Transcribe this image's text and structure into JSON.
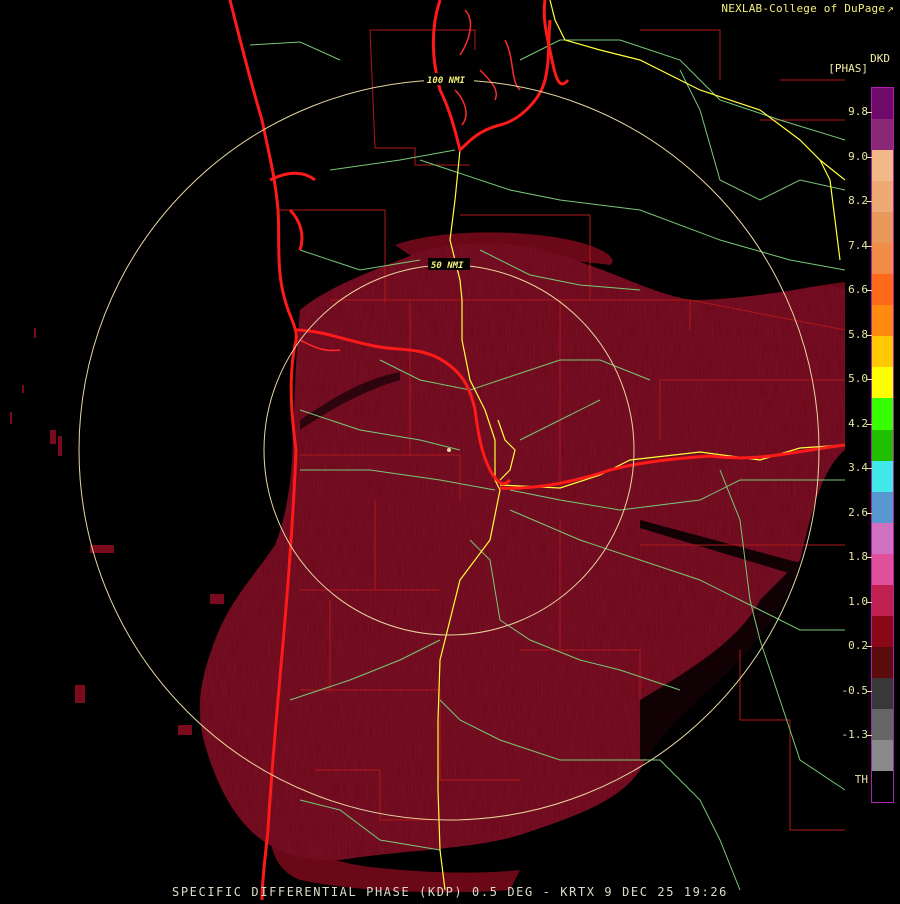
{
  "header": {
    "credit": "NEXLAB-College of DuPage",
    "credit_icon": "external-link-icon"
  },
  "footer": {
    "title": "SPECIFIC DIFFERENTIAL PHASE (KDP) 0.5 DEG - KRTX 9 DEC 25 19:26"
  },
  "map": {
    "range_rings": [
      {
        "label": "50 NMI",
        "range_nmi": 50
      },
      {
        "label": "100 NMI",
        "range_nmi": 100
      }
    ],
    "colors": {
      "background": "#000000",
      "echo_fill": "#6a0818",
      "state_borders": "#ff1a1a",
      "county_lines": "#b01818",
      "highways": "#78c878",
      "interstates": "#ffff3c",
      "range_rings": "#e8d6a0",
      "ring_labels": "#f6f27a"
    }
  },
  "colorbar": {
    "product": "DKD",
    "units": "[PHAS]",
    "ticks": [
      "9.8",
      "9.0",
      "8.2",
      "7.4",
      "6.6",
      "5.8",
      "5.0",
      "4.2",
      "3.4",
      "2.6",
      "1.8",
      "1.0",
      "0.2",
      "-0.5",
      "-1.3",
      "TH"
    ],
    "swatches": [
      "#700a6a",
      "#8a2878",
      "#f2b888",
      "#eeaa74",
      "#e8985a",
      "#f08c48",
      "#ff6a1a",
      "#ff8a10",
      "#ffc800",
      "#ffff00",
      "#38ff00",
      "#20c000",
      "#40e8e8",
      "#5898d0",
      "#d070c0",
      "#e0509a",
      "#c02050",
      "#8a0818",
      "#5a0c0c",
      "#383838",
      "#666666",
      "#8a8a8a",
      "#000000"
    ]
  }
}
